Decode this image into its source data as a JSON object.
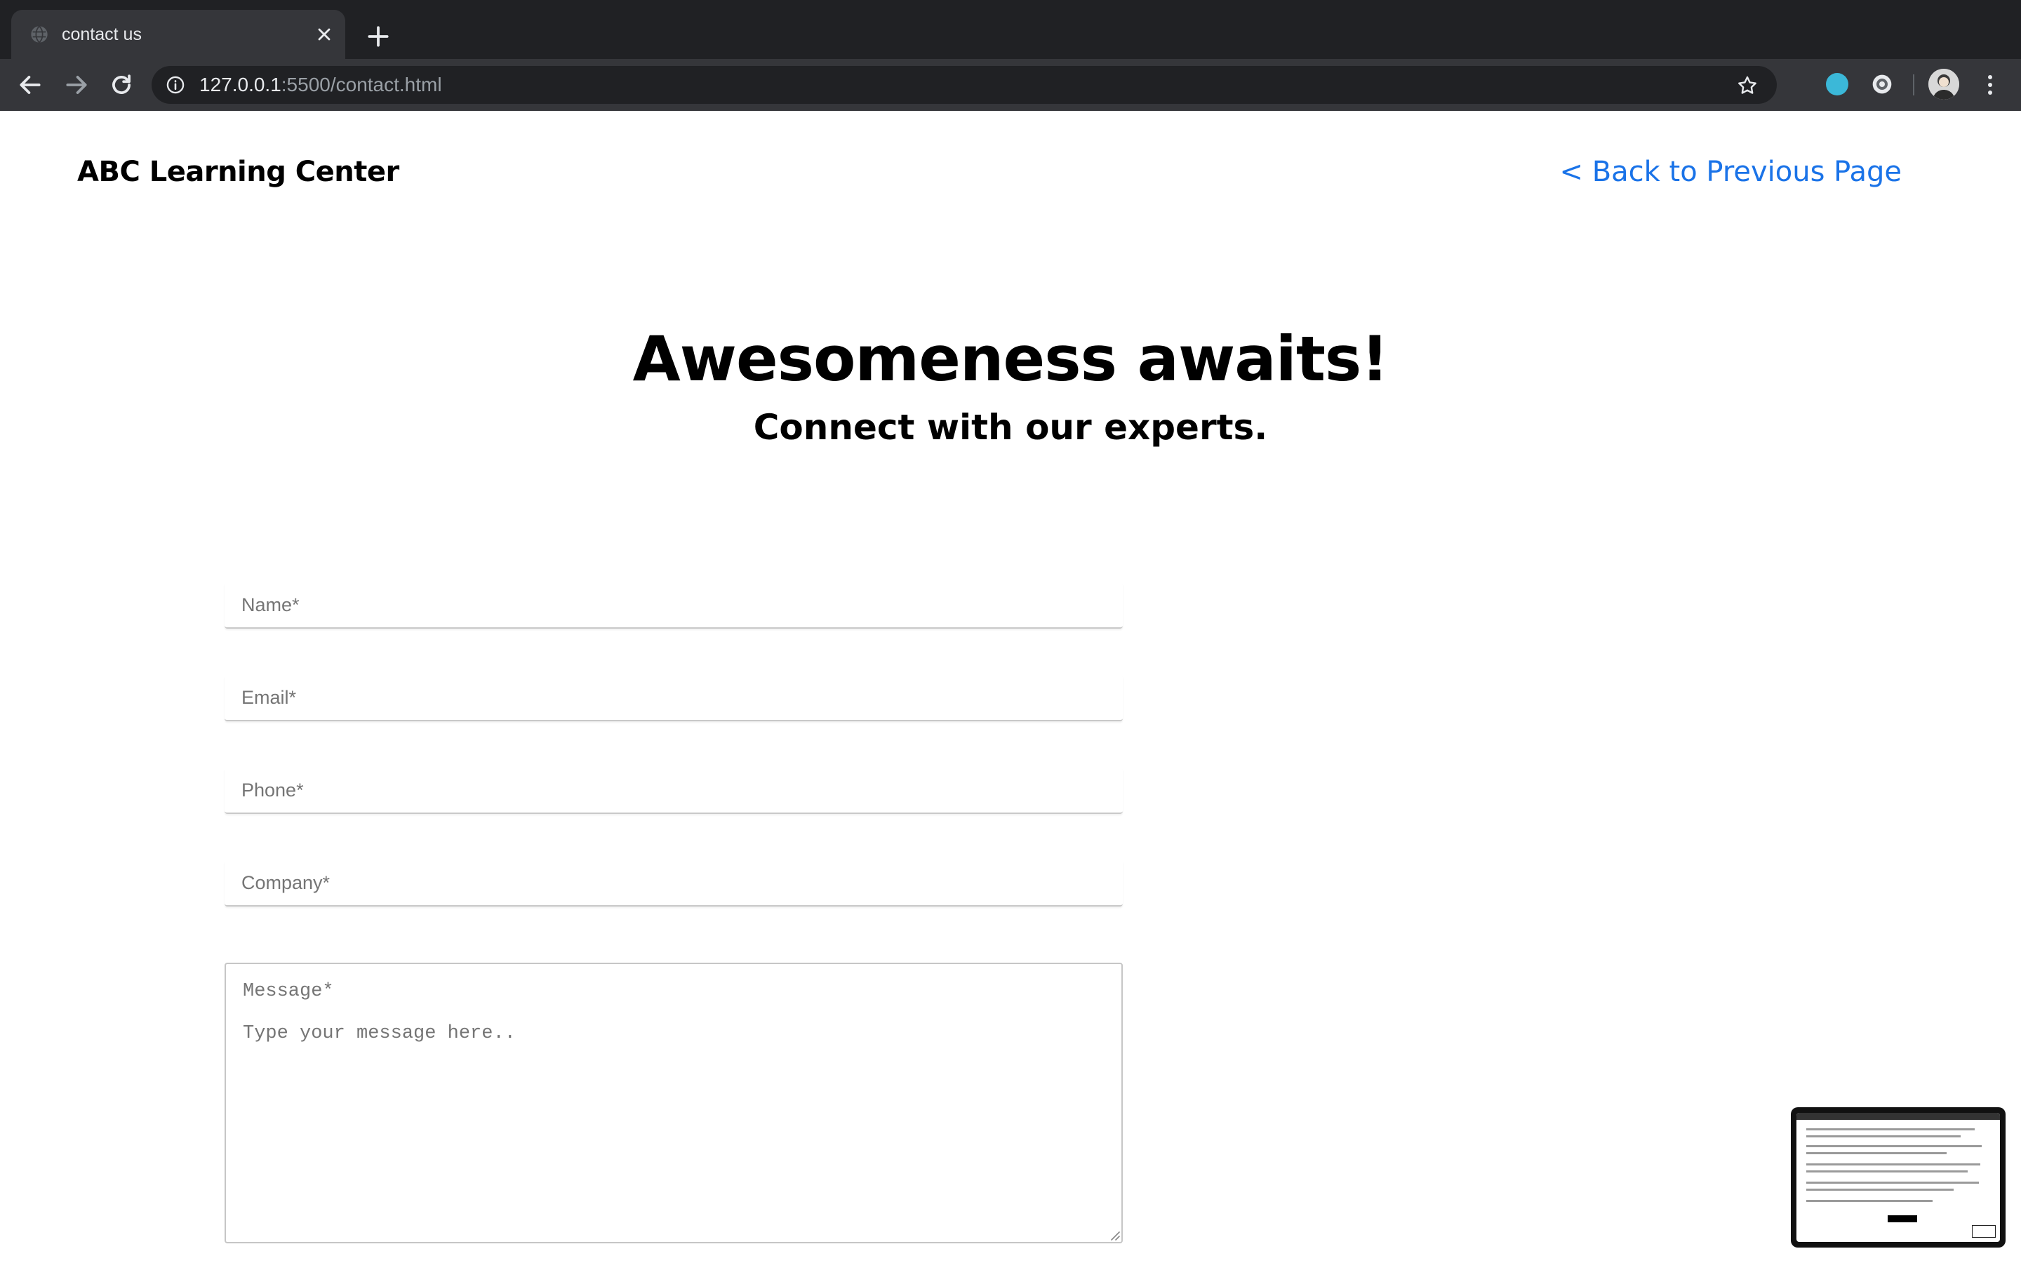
{
  "browser": {
    "tab_title": "contact us",
    "url_host": "127.0.0.1",
    "url_rest": ":5500/contact.html",
    "icons": [
      "globe-icon",
      "close-icon",
      "plus-icon",
      "back-arrow-icon",
      "forward-arrow-icon",
      "reload-icon",
      "info-icon",
      "star-icon",
      "extension-icon",
      "profile-avatar",
      "more-vert-icon"
    ]
  },
  "header": {
    "brand": "ABC Learning Center",
    "back_link": "< Back to Previous Page"
  },
  "hero": {
    "title": "Awesomeness awaits!",
    "subtitle": "Connect with our experts."
  },
  "form": {
    "name_placeholder": "Name*",
    "email_placeholder": "Email*",
    "phone_placeholder": "Phone*",
    "company_placeholder": "Company*",
    "message_label": "Message*",
    "message_placeholder": "Type your message here.."
  },
  "colors": {
    "link": "#1a73e8",
    "chrome_dark": "#202124",
    "chrome_toolbar": "#35363a",
    "extension_accent": "#3bb8d8"
  }
}
